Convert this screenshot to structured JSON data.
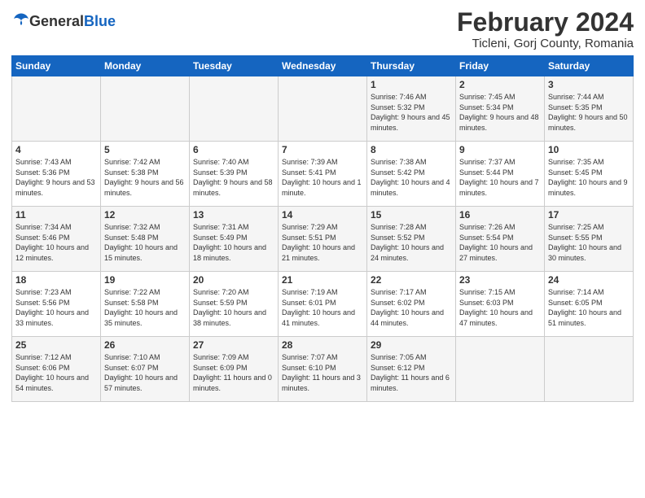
{
  "logo": {
    "general": "General",
    "blue": "Blue"
  },
  "title": "February 2024",
  "subtitle": "Ticleni, Gorj County, Romania",
  "headers": [
    "Sunday",
    "Monday",
    "Tuesday",
    "Wednesday",
    "Thursday",
    "Friday",
    "Saturday"
  ],
  "weeks": [
    [
      {
        "day": "",
        "info": ""
      },
      {
        "day": "",
        "info": ""
      },
      {
        "day": "",
        "info": ""
      },
      {
        "day": "",
        "info": ""
      },
      {
        "day": "1",
        "info": "Sunrise: 7:46 AM\nSunset: 5:32 PM\nDaylight: 9 hours\nand 45 minutes."
      },
      {
        "day": "2",
        "info": "Sunrise: 7:45 AM\nSunset: 5:34 PM\nDaylight: 9 hours\nand 48 minutes."
      },
      {
        "day": "3",
        "info": "Sunrise: 7:44 AM\nSunset: 5:35 PM\nDaylight: 9 hours\nand 50 minutes."
      }
    ],
    [
      {
        "day": "4",
        "info": "Sunrise: 7:43 AM\nSunset: 5:36 PM\nDaylight: 9 hours\nand 53 minutes."
      },
      {
        "day": "5",
        "info": "Sunrise: 7:42 AM\nSunset: 5:38 PM\nDaylight: 9 hours\nand 56 minutes."
      },
      {
        "day": "6",
        "info": "Sunrise: 7:40 AM\nSunset: 5:39 PM\nDaylight: 9 hours\nand 58 minutes."
      },
      {
        "day": "7",
        "info": "Sunrise: 7:39 AM\nSunset: 5:41 PM\nDaylight: 10 hours\nand 1 minute."
      },
      {
        "day": "8",
        "info": "Sunrise: 7:38 AM\nSunset: 5:42 PM\nDaylight: 10 hours\nand 4 minutes."
      },
      {
        "day": "9",
        "info": "Sunrise: 7:37 AM\nSunset: 5:44 PM\nDaylight: 10 hours\nand 7 minutes."
      },
      {
        "day": "10",
        "info": "Sunrise: 7:35 AM\nSunset: 5:45 PM\nDaylight: 10 hours\nand 9 minutes."
      }
    ],
    [
      {
        "day": "11",
        "info": "Sunrise: 7:34 AM\nSunset: 5:46 PM\nDaylight: 10 hours\nand 12 minutes."
      },
      {
        "day": "12",
        "info": "Sunrise: 7:32 AM\nSunset: 5:48 PM\nDaylight: 10 hours\nand 15 minutes."
      },
      {
        "day": "13",
        "info": "Sunrise: 7:31 AM\nSunset: 5:49 PM\nDaylight: 10 hours\nand 18 minutes."
      },
      {
        "day": "14",
        "info": "Sunrise: 7:29 AM\nSunset: 5:51 PM\nDaylight: 10 hours\nand 21 minutes."
      },
      {
        "day": "15",
        "info": "Sunrise: 7:28 AM\nSunset: 5:52 PM\nDaylight: 10 hours\nand 24 minutes."
      },
      {
        "day": "16",
        "info": "Sunrise: 7:26 AM\nSunset: 5:54 PM\nDaylight: 10 hours\nand 27 minutes."
      },
      {
        "day": "17",
        "info": "Sunrise: 7:25 AM\nSunset: 5:55 PM\nDaylight: 10 hours\nand 30 minutes."
      }
    ],
    [
      {
        "day": "18",
        "info": "Sunrise: 7:23 AM\nSunset: 5:56 PM\nDaylight: 10 hours\nand 33 minutes."
      },
      {
        "day": "19",
        "info": "Sunrise: 7:22 AM\nSunset: 5:58 PM\nDaylight: 10 hours\nand 35 minutes."
      },
      {
        "day": "20",
        "info": "Sunrise: 7:20 AM\nSunset: 5:59 PM\nDaylight: 10 hours\nand 38 minutes."
      },
      {
        "day": "21",
        "info": "Sunrise: 7:19 AM\nSunset: 6:01 PM\nDaylight: 10 hours\nand 41 minutes."
      },
      {
        "day": "22",
        "info": "Sunrise: 7:17 AM\nSunset: 6:02 PM\nDaylight: 10 hours\nand 44 minutes."
      },
      {
        "day": "23",
        "info": "Sunrise: 7:15 AM\nSunset: 6:03 PM\nDaylight: 10 hours\nand 47 minutes."
      },
      {
        "day": "24",
        "info": "Sunrise: 7:14 AM\nSunset: 6:05 PM\nDaylight: 10 hours\nand 51 minutes."
      }
    ],
    [
      {
        "day": "25",
        "info": "Sunrise: 7:12 AM\nSunset: 6:06 PM\nDaylight: 10 hours\nand 54 minutes."
      },
      {
        "day": "26",
        "info": "Sunrise: 7:10 AM\nSunset: 6:07 PM\nDaylight: 10 hours\nand 57 minutes."
      },
      {
        "day": "27",
        "info": "Sunrise: 7:09 AM\nSunset: 6:09 PM\nDaylight: 11 hours\nand 0 minutes."
      },
      {
        "day": "28",
        "info": "Sunrise: 7:07 AM\nSunset: 6:10 PM\nDaylight: 11 hours\nand 3 minutes."
      },
      {
        "day": "29",
        "info": "Sunrise: 7:05 AM\nSunset: 6:12 PM\nDaylight: 11 hours\nand 6 minutes."
      },
      {
        "day": "",
        "info": ""
      },
      {
        "day": "",
        "info": ""
      }
    ]
  ]
}
